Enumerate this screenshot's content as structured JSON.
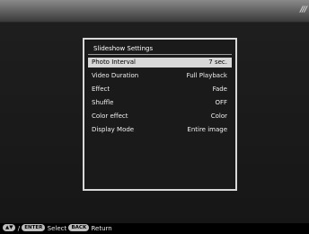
{
  "topbar": {
    "mark": "///"
  },
  "panel": {
    "title": "Slideshow Settings",
    "items": [
      {
        "label": "Photo Interval",
        "value": "7 sec."
      },
      {
        "label": "Video Duration",
        "value": "Full Playback"
      },
      {
        "label": "Effect",
        "value": "Fade"
      },
      {
        "label": "Shuffle",
        "value": "OFF"
      },
      {
        "label": "Color effect",
        "value": "Color"
      },
      {
        "label": "Display Mode",
        "value": "Entire image"
      }
    ]
  },
  "footer": {
    "nav_key": "▲▼",
    "sep": "/",
    "enter_key": "ENTER",
    "select_label": "Select",
    "back_key": "BACK",
    "return_label": "Return"
  }
}
